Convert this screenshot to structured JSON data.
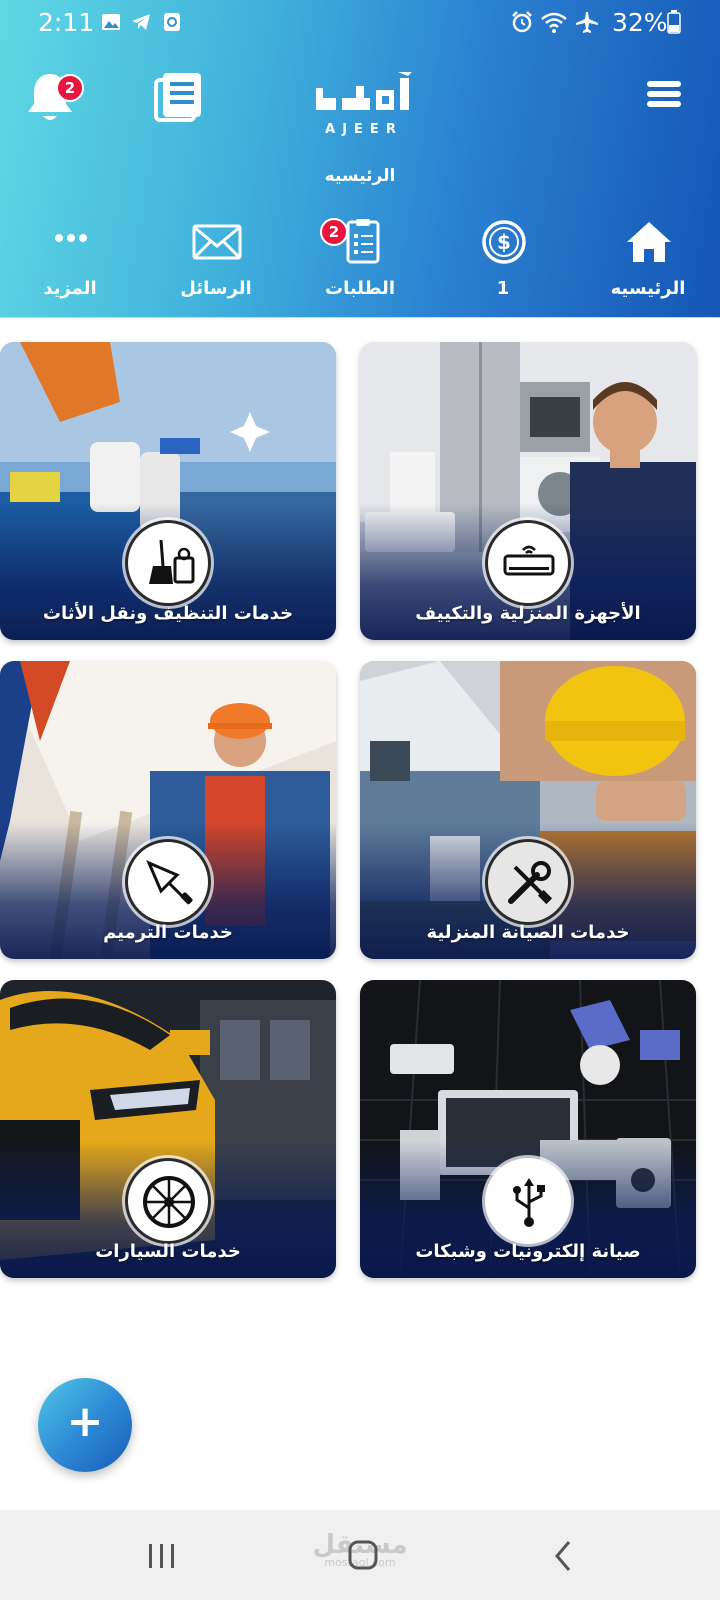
{
  "status_bar": {
    "time": "2:11",
    "battery_pct": "32%",
    "icons": [
      "gallery-icon",
      "telegram-icon",
      "app-icon",
      "alarm-icon",
      "wifi-icon",
      "airplane-icon",
      "battery-icon"
    ]
  },
  "header": {
    "logo_text": "AJEER",
    "page_title": "الرئيسيه",
    "notifications_badge": "2",
    "icons": [
      "bell-icon",
      "orders-document-icon",
      "menu-icon"
    ]
  },
  "quick_nav": [
    {
      "label": "الرئيسيه",
      "icon": "home-icon"
    },
    {
      "label": "1",
      "icon": "dollar-coin-icon"
    },
    {
      "label": "الطلبات",
      "icon": "clipboard-icon",
      "badge": "2"
    },
    {
      "label": "الرسائل",
      "icon": "envelope-icon"
    },
    {
      "label": "المزيد",
      "icon": "more-dots-icon"
    }
  ],
  "services": [
    {
      "label": "الأجهزة المنزلية والتكييف",
      "icon": "air-conditioner-icon"
    },
    {
      "label": "خدمات التنظيف ونقل الأثاث",
      "icon": "broom-bucket-icon"
    },
    {
      "label": "خدمات الصيانة المنزلية",
      "icon": "wrench-screwdriver-icon"
    },
    {
      "label": "خدمات الترميم",
      "icon": "trowel-icon"
    },
    {
      "label": "صيانة إلكترونيات وشبكات",
      "icon": "usb-icon"
    },
    {
      "label": "خدمات السيارات",
      "icon": "wheel-icon"
    }
  ],
  "fab": {
    "label": "+"
  },
  "watermark": {
    "arabic": "مستقل",
    "latin": "mostaql.com"
  },
  "colors": {
    "header_start": "#5fd8e3",
    "header_end": "#1456b5",
    "badge": "#e8163e",
    "card_label_band": "#0a1e5a"
  }
}
